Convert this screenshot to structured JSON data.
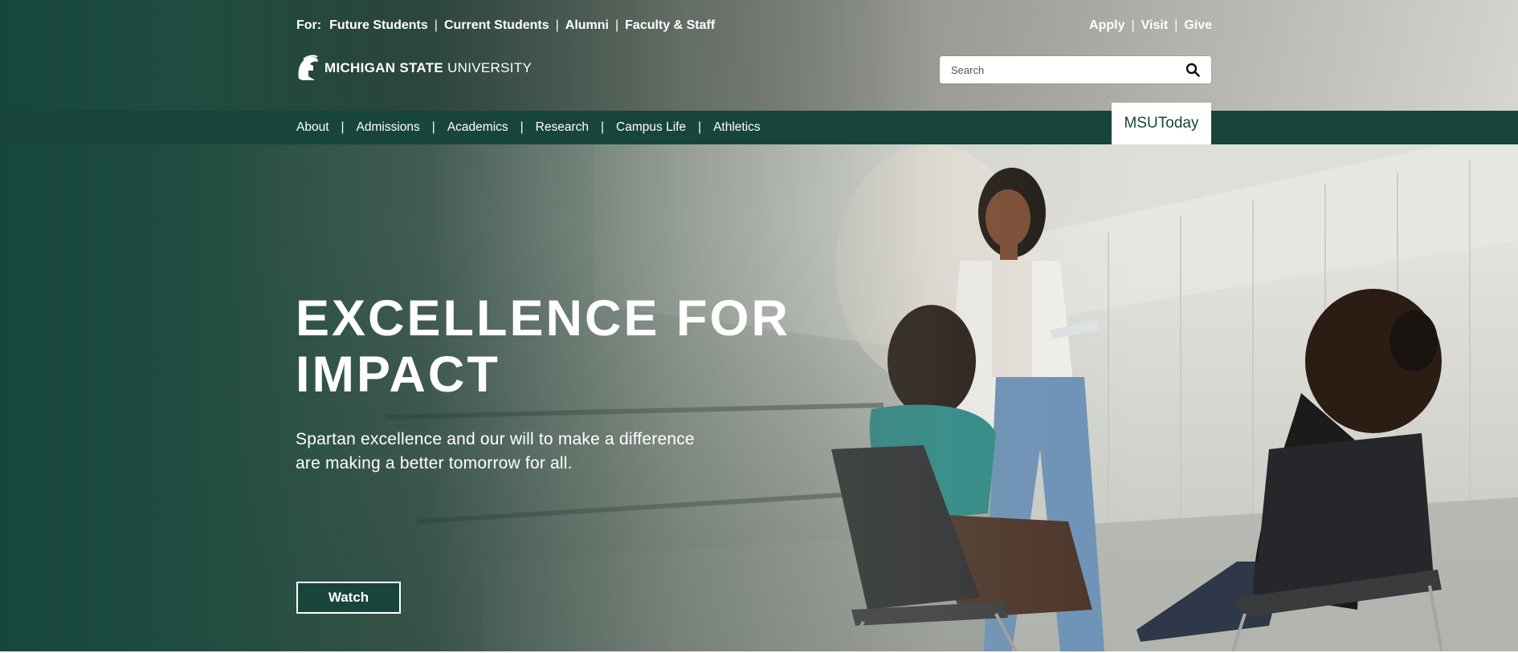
{
  "utility_nav": {
    "for_label": "For:",
    "audience_links": [
      "Future Students",
      "Current Students",
      "Alumni",
      "Faculty & Staff"
    ],
    "action_links": [
      "Apply",
      "Visit",
      "Give"
    ],
    "separator": "|"
  },
  "logo": {
    "name_bold": "MICHIGAN STATE",
    "name_light": "UNIVERSITY",
    "icon": "spartan-helmet-icon"
  },
  "search": {
    "placeholder": "Search",
    "value": "",
    "icon": "search-icon"
  },
  "main_nav": {
    "items": [
      "About",
      "Admissions",
      "Academics",
      "Research",
      "Campus Life",
      "Athletics"
    ],
    "separator": "|",
    "featured_link": "MSUToday"
  },
  "hero": {
    "title_line1": "EXCELLENCE FOR",
    "title_line2": "IMPACT",
    "subtitle": "Spartan excellence and our will to make a difference are making a better tomorrow for all.",
    "button_label": "Watch"
  },
  "colors": {
    "brand_green": "#18453b",
    "white": "#ffffff"
  }
}
